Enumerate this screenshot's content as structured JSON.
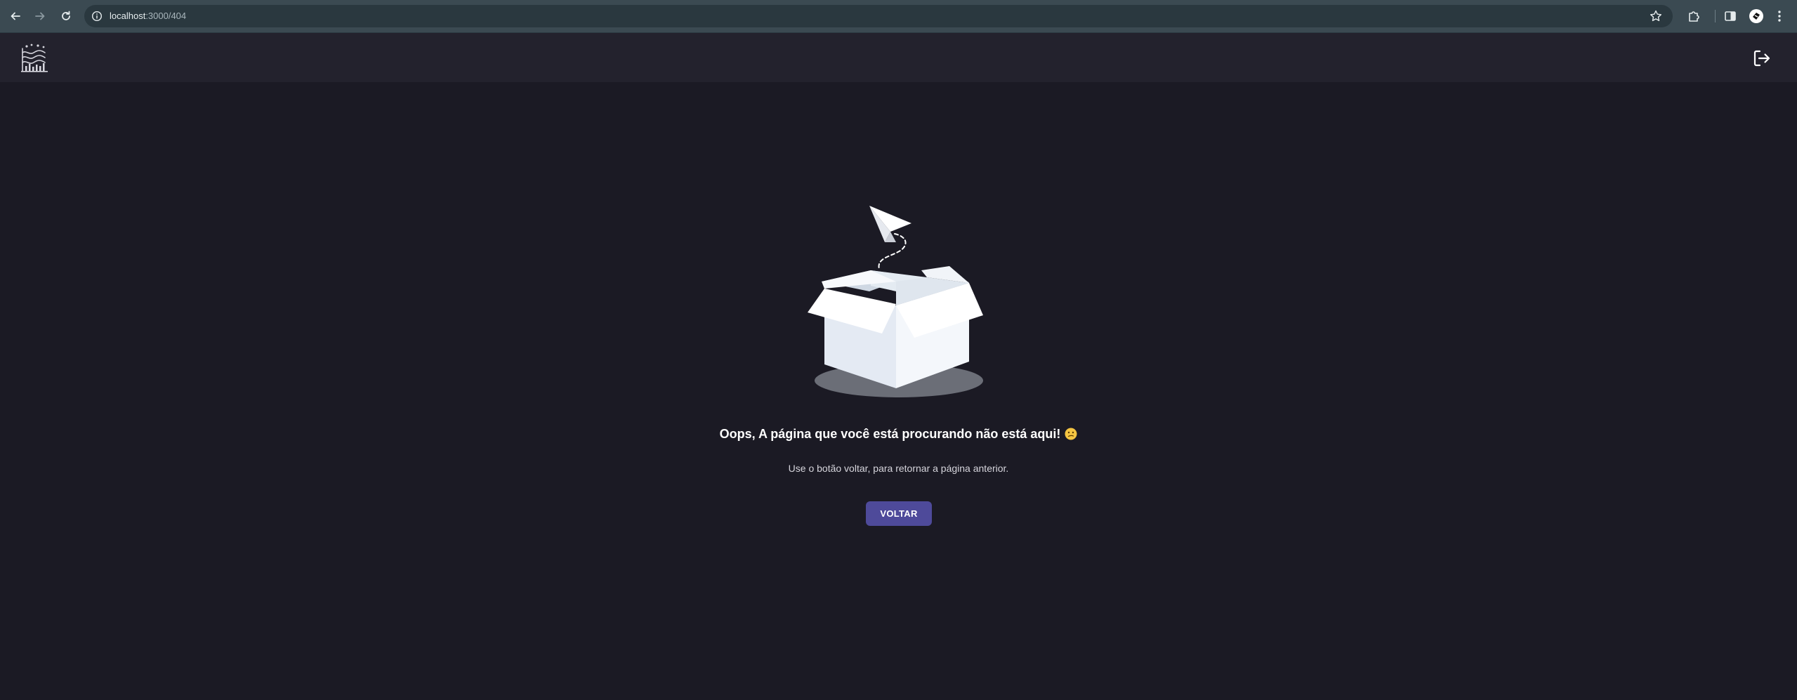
{
  "browser": {
    "url_host": "localhost",
    "url_path": ":3000/404"
  },
  "app": {
    "logo_icon": "chart-flag-logo-icon",
    "logout_icon": "logout-icon"
  },
  "error": {
    "title": "Oops, A página que você está procurando não está aqui!",
    "emoji": "confused-face-icon",
    "subtitle": "Use o botão voltar, para retornar a página anterior.",
    "back_label": "VOLTAR"
  },
  "colors": {
    "page_bg": "#1b1a24",
    "header_bg": "#23222d",
    "browser_bar": "#3b4a52",
    "button_bg": "#4e4a9a"
  }
}
